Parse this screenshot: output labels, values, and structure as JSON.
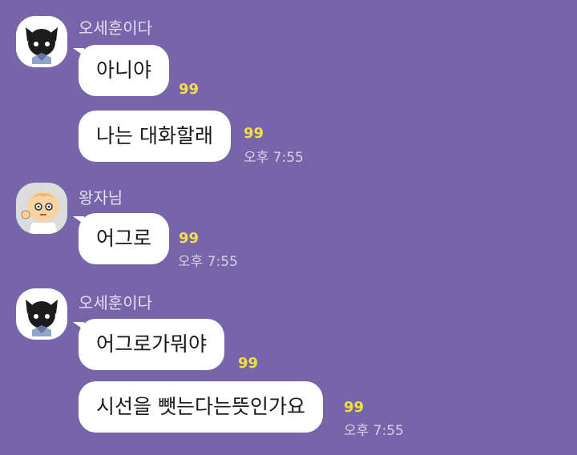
{
  "groups": [
    {
      "sender": "오세훈이다",
      "avatar": "kuromi-style-cat-avatar-icon",
      "messages": [
        {
          "text": "아니야",
          "unread": "99",
          "time": ""
        },
        {
          "text": "나는 대화할래",
          "unread": "99",
          "time": "오후 7:55"
        }
      ]
    },
    {
      "sender": "왕자님",
      "avatar": "peach-character-avatar-icon",
      "messages": [
        {
          "text": "어그로",
          "unread": "99",
          "time": "오후 7:55"
        }
      ]
    },
    {
      "sender": "오세훈이다",
      "avatar": "kuromi-style-cat-avatar-icon",
      "messages": [
        {
          "text": "어그로가뭐야",
          "unread": "99",
          "time": ""
        },
        {
          "text": "시선을 뺏는다는뜻인가요",
          "unread": "99",
          "time": "오후 7:55"
        }
      ]
    }
  ],
  "colors": {
    "background": "#7665a8",
    "bubble": "#ffffff",
    "unread": "#f2de4b",
    "meta_text": "#d7d0ec"
  }
}
